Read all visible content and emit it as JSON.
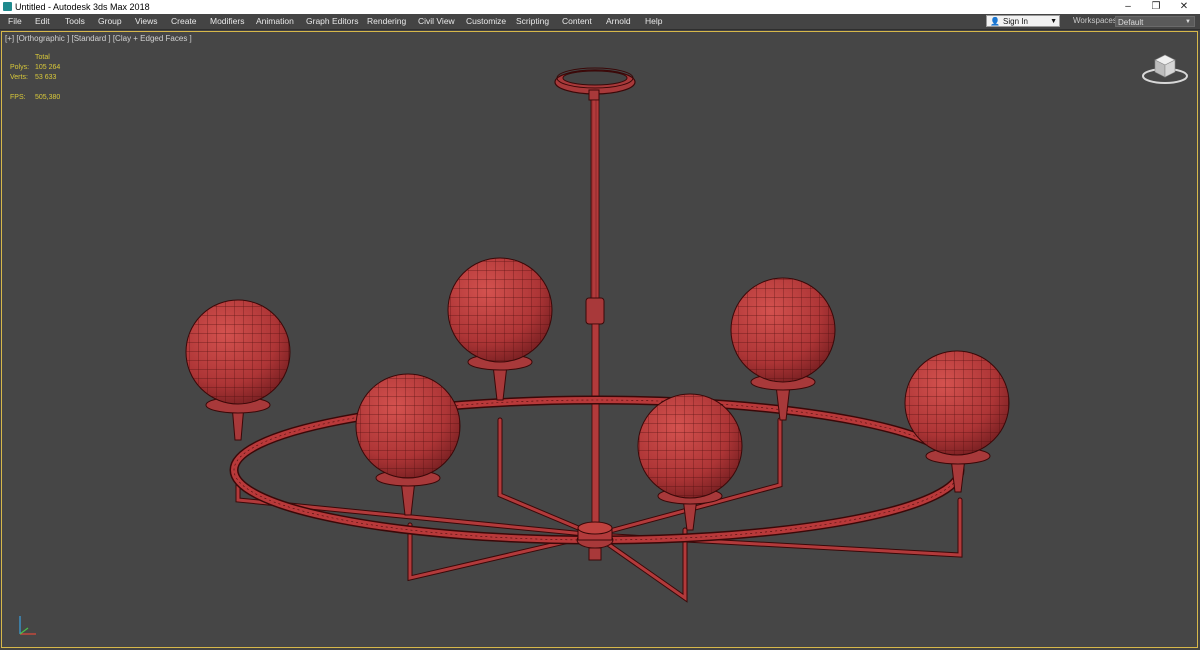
{
  "window": {
    "title": "Untitled - Autodesk 3ds Max 2018",
    "minimize": "–",
    "restore": "❐",
    "close": "✕"
  },
  "menu": {
    "items": [
      "File",
      "Edit",
      "Tools",
      "Group",
      "Views",
      "Create",
      "Modifiers",
      "Animation",
      "Graph Editors",
      "Rendering",
      "Civil View",
      "Customize",
      "Scripting",
      "Content",
      "Arnold",
      "Help"
    ],
    "signin_label": "Sign In",
    "workspaces_label": "Workspaces:",
    "workspace_value": "Default"
  },
  "viewport": {
    "label": "[+] [Orthographic ] [Standard ] [Clay + Edged Faces ]",
    "stats": {
      "total_label": "Total",
      "polys_label": "Polys:",
      "polys_value": "105 264",
      "verts_label": "Verts:",
      "verts_value": "53 633",
      "fps_label": "FPS:",
      "fps_value": "505,380"
    }
  },
  "colors": {
    "viewport_bg": "#464646",
    "model": "#b8393a",
    "wire": "#4a0c0c",
    "stats_text": "#d9c93a",
    "viewport_border": "#d7b84a"
  }
}
